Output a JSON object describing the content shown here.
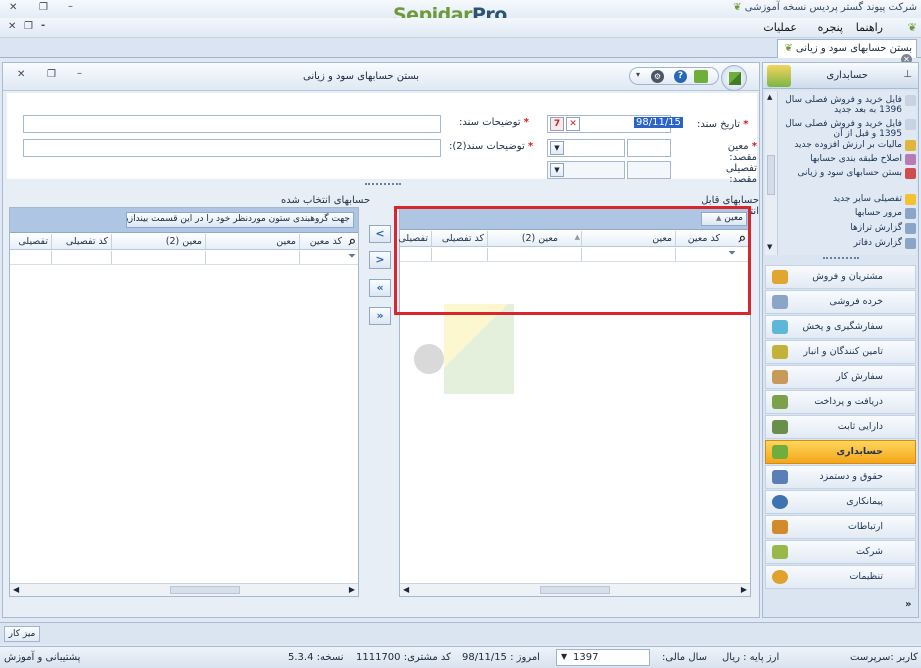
{
  "app": {
    "brand_part1": "Sepidar",
    "brand_part2": "Pro",
    "company_title": "شرکت پیوند گستر پردیس نسخه آموزشی"
  },
  "menu": {
    "operations": "عملیات",
    "help": "راهنما",
    "window": "پنجره"
  },
  "doc_tab": {
    "label": "بستن حسابهای سود و زیانی"
  },
  "panel": {
    "title": "بستن حسابهای سود و زیانی"
  },
  "form": {
    "date_label": "تاریخ سند:",
    "date_value": "98/11/15",
    "desc_label": "توضیحات سند:",
    "desc2_label": "توضیحات سند(2):",
    "dest_account_label": "معین مقصد:",
    "dest_detail_label": "تفصیلی مقصد:"
  },
  "left_grid": {
    "title": "حسابهای قابل انتخاب",
    "group_chip": "معین",
    "columns": [
      "کد معین",
      "معین",
      "معین (2)",
      "کد تفصیلی",
      "تفصیلی"
    ]
  },
  "right_grid": {
    "title": "حسابهای انتخاب شده",
    "group_hint": "جهت گروهبندی ستون موردنظر خود را در این قسمت بیندازید",
    "columns": [
      "کد معین",
      "معین",
      "معین (2)",
      "کد تفصیلی",
      "تفصیلی"
    ]
  },
  "nav_buttons": [
    "<",
    ">",
    "«",
    "»"
  ],
  "sidebar": {
    "header": "حسابداری",
    "tasks": [
      "فایل خرید و فروش فصلی سال 1396 به بعد جدید",
      "فایل خرید و فروش فصلی سال 1395 و قبل از آن",
      "مالیات بر ارزش افزوده جدید",
      "اصلاح طبقه بندی حسابها",
      "بستن حسابهای سود و زیانی",
      "تفصیلی سایر جدید",
      "مرور حسابها",
      "گزارش ترازها",
      "گزارش دفاتر"
    ],
    "modules": [
      "مشتریان و فروش",
      "خرده فروشی",
      "سفارشگیری و پخش",
      "تامین کنندگان و انبار",
      "سفارش کار",
      "دریافت و پرداخت",
      "دارایی ثابت",
      "حسابداری",
      "حقوق و دستمزد",
      "پیمانکاری",
      "ارتباطات",
      "شرکت",
      "تنظیمات"
    ],
    "active_module": "حسابداری"
  },
  "bottom": {
    "desk_label": "میز کار"
  },
  "status": {
    "user": "نام کاربر :سرپرست",
    "base_currency": "ارز پایه : ریال",
    "fiscal_year_label": "سال مالی:",
    "fiscal_year_value": "1397",
    "today": "امروز : 98/11/15",
    "customer_code": "کد مشتری: 1111700",
    "version": "نسخه: 5.3.4",
    "support": "پشتیبانی و آموزش"
  },
  "colors": {
    "accent": "#2867b3",
    "active_module": "#f4a51b",
    "highlight": "#d7262c",
    "brand_green": "#6e9a3a"
  }
}
